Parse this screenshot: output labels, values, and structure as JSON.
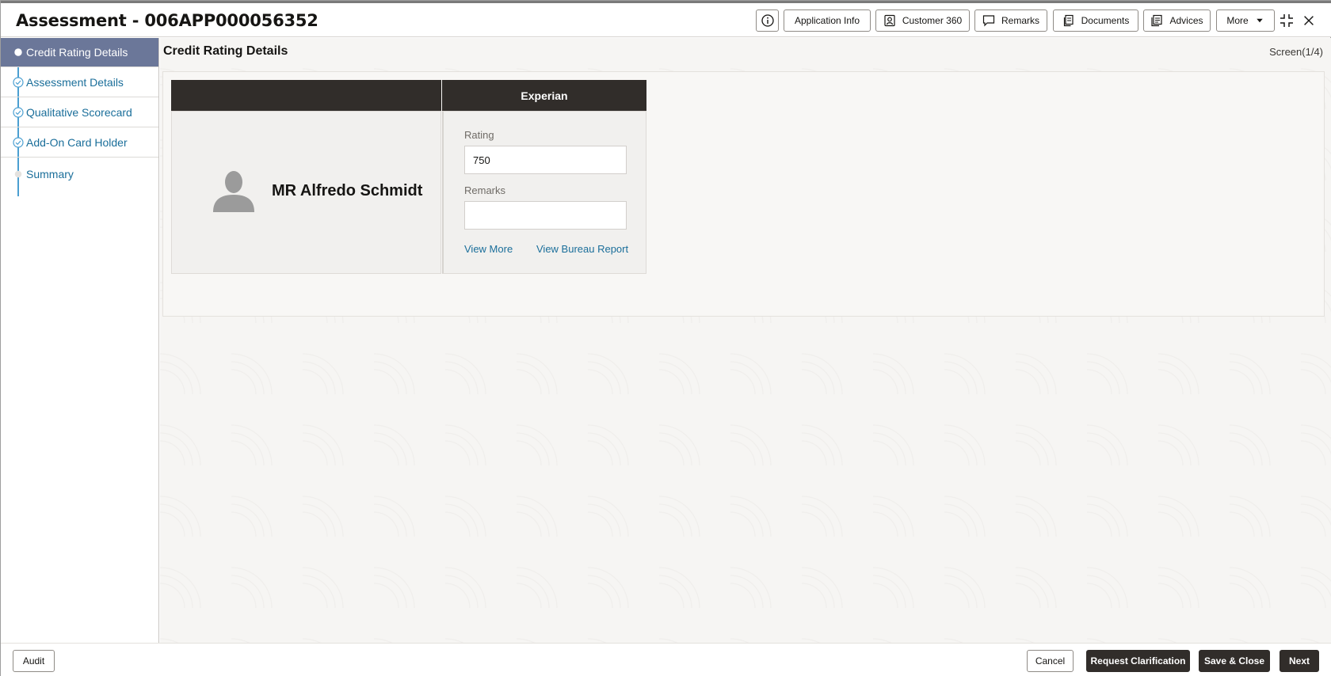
{
  "header": {
    "title": "Assessment - 006APP000056352",
    "buttons": {
      "application_info": "Application Info",
      "customer_360": "Customer 360",
      "remarks": "Remarks",
      "documents": "Documents",
      "advices": "Advices",
      "more": "More"
    }
  },
  "sidebar": {
    "items": [
      {
        "label": "Credit Rating Details",
        "state": "active"
      },
      {
        "label": "Assessment Details",
        "state": "done"
      },
      {
        "label": "Qualitative Scorecard",
        "state": "done"
      },
      {
        "label": "Add-On Card Holder",
        "state": "done"
      },
      {
        "label": "Summary",
        "state": "pending"
      }
    ]
  },
  "main": {
    "section_title": "Credit Rating Details",
    "screen_count": "Screen(1/4)",
    "card": {
      "bureau_header": "Experian",
      "applicant_name": "MR Alfredo Schmidt",
      "rating_label": "Rating",
      "rating_value": "750",
      "remarks_label": "Remarks",
      "remarks_value": "",
      "view_more": "View More",
      "view_bureau_report": "View Bureau Report"
    }
  },
  "footer": {
    "audit": "Audit",
    "cancel": "Cancel",
    "request_clarification": "Request Clarification",
    "save_close": "Save & Close",
    "next": "Next"
  },
  "colors": {
    "active_step_bg": "#6b7799",
    "link": "#1a6e9a",
    "dark_button": "#312d2a",
    "step_line": "#4a9fd1"
  }
}
